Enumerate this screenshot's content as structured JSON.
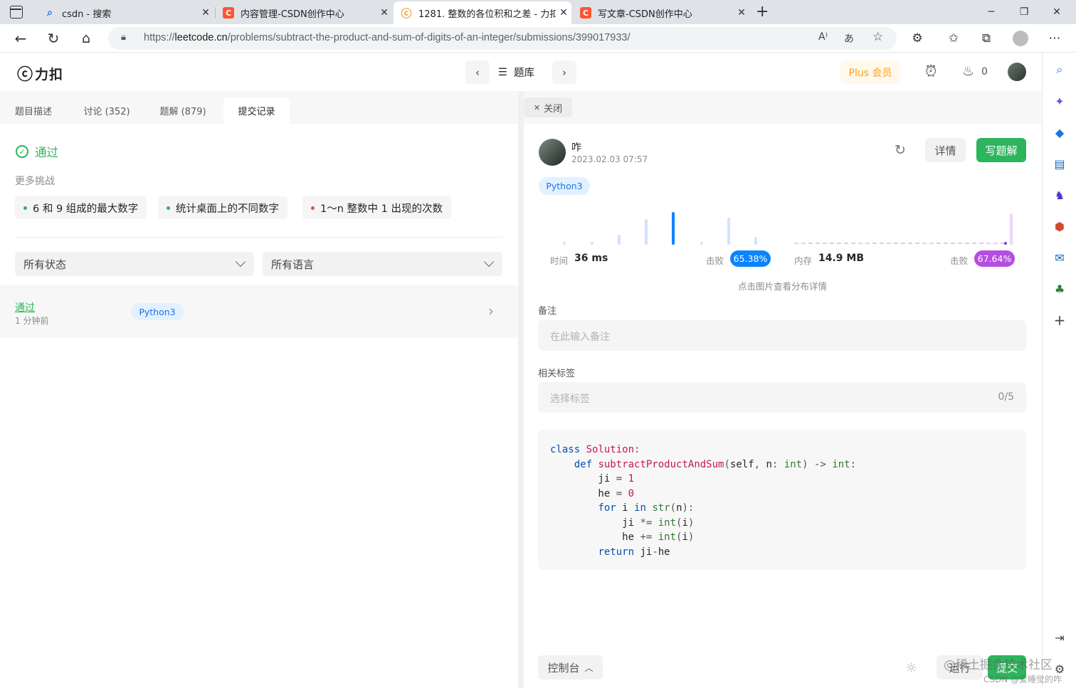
{
  "browser": {
    "tabs": [
      {
        "icon": "search-icon",
        "title": "csdn - 搜索"
      },
      {
        "icon": "csdn-icon",
        "title": "内容管理-CSDN创作中心"
      },
      {
        "icon": "leetcode-icon",
        "title": "1281. 整数的各位积和之差 - 力扣"
      },
      {
        "icon": "csdn-icon",
        "title": "写文章-CSDN创作中心"
      }
    ],
    "url_prefix": "https://",
    "url_host": "leetcode.cn",
    "url_path": "/problems/subtract-the-product-and-sum-of-digits-of-an-integer/submissions/399017933/"
  },
  "header": {
    "logo_text": "力扣",
    "problem_list_label": "题库",
    "plus_label": "Plus 会员",
    "streak_count": "0"
  },
  "left": {
    "tabs": [
      "题目描述",
      "讨论 (352)",
      "题解 (879)",
      "提交记录"
    ],
    "status": "通过",
    "more_challenges_label": "更多挑战",
    "challenges": [
      {
        "label": "6 和 9 组成的最大数字",
        "dot_color": "#2db55d"
      },
      {
        "label": "统计桌面上的不同数字",
        "dot_color": "#2db55d"
      },
      {
        "label": "1～n 整数中 1 出现的次数",
        "dot_color": "#ef4743"
      }
    ],
    "filter_status": "所有状态",
    "filter_language": "所有语言",
    "submission": {
      "status": "通过",
      "time": "1 分钟前",
      "language": "Python3"
    }
  },
  "right": {
    "close_label": "关闭",
    "user_name": "咋",
    "submit_time": "2023.02.03 07:57",
    "detail_label": "详情",
    "write_solution_label": "写题解",
    "language": "Python3",
    "runtime_label": "时间",
    "runtime_value": "36 ms",
    "beat_label": "击败",
    "runtime_beat": "65.38%",
    "memory_label": "内存",
    "memory_value": "14.9 MB",
    "memory_beat": "67.64%",
    "chart_hint": "点击图片查看分布详情",
    "notes_label": "备注",
    "notes_placeholder": "在此输入备注",
    "tags_label": "相关标签",
    "tags_placeholder": "选择标签",
    "tags_count": "0/5",
    "console_label": "控制台",
    "run_label": "运行",
    "submit_label": "提交",
    "watermark": "@稀土掘金技术社区",
    "watermark2": "CSDN @爱睡觉的咋"
  },
  "code_lines": [
    "class Solution:",
    "    def subtractProductAndSum(self, n: int) -> int:",
    "        ji = 1",
    "        he = 0",
    "        for i in str(n):",
    "            ji *= int(i)",
    "            he += int(i)",
    "        return ji-he"
  ],
  "colors": {
    "accent_green": "#2db55d",
    "runtime_blue": "#0a84ff",
    "memory_purple": "#b44ee0",
    "plus_orange": "#ffa116"
  }
}
